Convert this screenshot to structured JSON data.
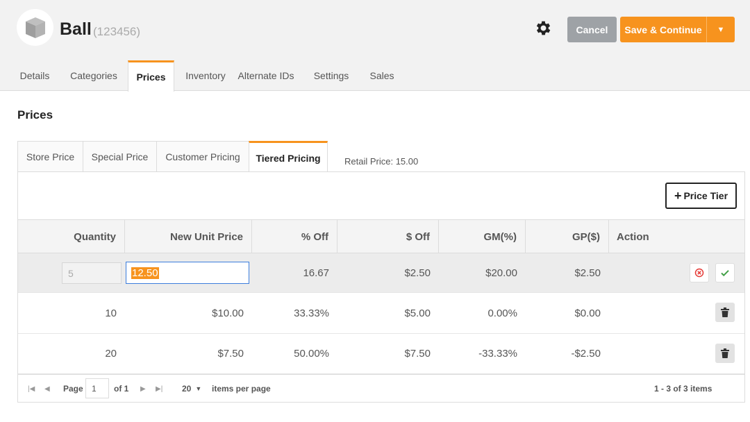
{
  "header": {
    "title": "Ball",
    "subtitle": "(123456)",
    "cancel_label": "Cancel",
    "save_label": "Save & Continue",
    "accent": "#f7931e"
  },
  "tabs": [
    "Details",
    "Categories",
    "Prices",
    "Inventory",
    "Alternate IDs",
    "Settings",
    "Sales"
  ],
  "active_tab": "Prices",
  "section_title": "Prices",
  "subtabs": [
    "Store Price",
    "Special Price",
    "Customer Pricing",
    "Tiered Pricing"
  ],
  "active_subtab": "Tiered Pricing",
  "retail_price": "Retail Price: 15.00",
  "add_tier_label": "Price Tier",
  "columns": [
    "Quantity",
    "New Unit Price",
    "% Off",
    "$ Off",
    "GM(%)",
    "GP($)",
    "Action"
  ],
  "edit_row": {
    "quantity": "5",
    "price": "12.50",
    "pct_off": "16.67",
    "dollar_off": "$2.50",
    "gm": "$20.00",
    "gp": "$2.50"
  },
  "rows": [
    {
      "quantity": "10",
      "price": "$10.00",
      "pct_off": "33.33%",
      "dollar_off": "$5.00",
      "gm": "0.00%",
      "gp": "$0.00"
    },
    {
      "quantity": "20",
      "price": "$7.50",
      "pct_off": "50.00%",
      "dollar_off": "$7.50",
      "gm": "-33.33%",
      "gp": "-$2.50"
    }
  ],
  "pager": {
    "page_label": "Page",
    "page": "1",
    "of_label": "of 1",
    "per_page": "20",
    "per_page_label": "items per page",
    "summary": "1 - 3 of 3 items"
  }
}
